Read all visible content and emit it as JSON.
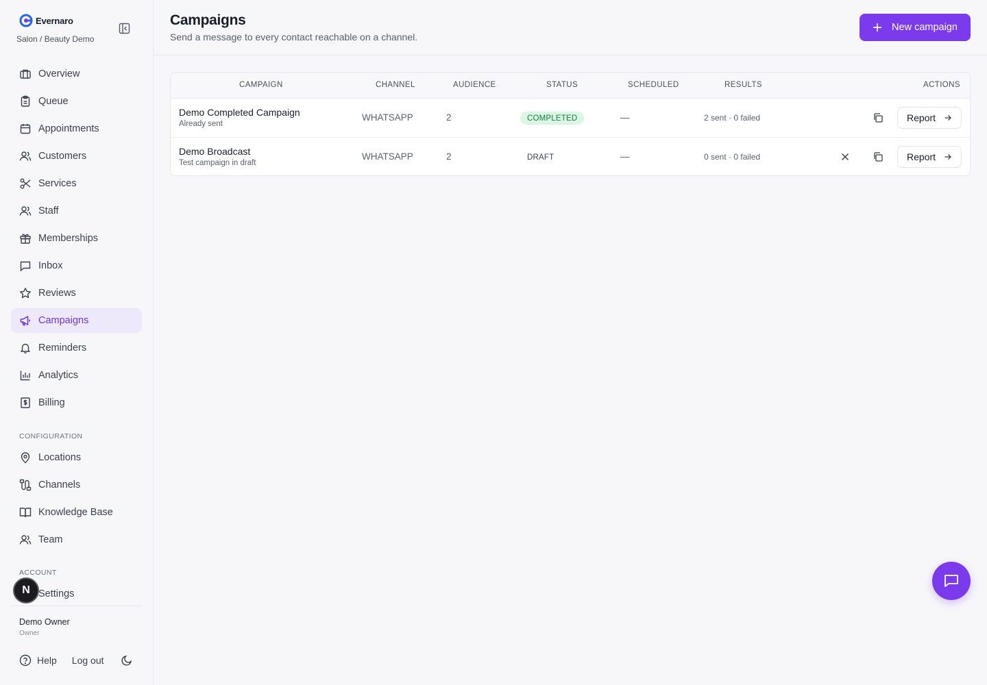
{
  "brand": {
    "name": "Evernaro",
    "workspace": "Salon / Beauty Demo"
  },
  "nav": {
    "items": [
      {
        "label": "Overview",
        "icon": "briefcase-icon"
      },
      {
        "label": "Queue",
        "icon": "clipboard-icon"
      },
      {
        "label": "Appointments",
        "icon": "calendar-icon"
      },
      {
        "label": "Customers",
        "icon": "users-icon"
      },
      {
        "label": "Services",
        "icon": "scissors-icon"
      },
      {
        "label": "Staff",
        "icon": "users-icon"
      },
      {
        "label": "Memberships",
        "icon": "gift-icon"
      },
      {
        "label": "Inbox",
        "icon": "message-square-icon"
      },
      {
        "label": "Reviews",
        "icon": "star-icon"
      },
      {
        "label": "Campaigns",
        "icon": "megaphone-icon",
        "active": true
      },
      {
        "label": "Reminders",
        "icon": "bell-icon"
      },
      {
        "label": "Analytics",
        "icon": "bar-chart-icon"
      },
      {
        "label": "Billing",
        "icon": "receipt-dollar-icon"
      }
    ],
    "configuration_label": "CONFIGURATION",
    "configuration": [
      {
        "label": "Locations",
        "icon": "map-pin-icon"
      },
      {
        "label": "Channels",
        "icon": "route-icon"
      },
      {
        "label": "Knowledge Base",
        "icon": "book-open-icon"
      },
      {
        "label": "Team",
        "icon": "users-icon"
      }
    ],
    "account_label": "ACCOUNT",
    "account": [
      {
        "label": "Settings",
        "icon": "gear-icon"
      }
    ]
  },
  "user": {
    "name": "Demo Owner",
    "role": "Owner",
    "avatar_letter": "N"
  },
  "footer": {
    "help": "Help",
    "logout": "Log out"
  },
  "header": {
    "title": "Campaigns",
    "subtitle": "Send a message to every contact reachable on a channel.",
    "new_button": "New campaign"
  },
  "table": {
    "columns": [
      "CAMPAIGN",
      "CHANNEL",
      "AUDIENCE",
      "STATUS",
      "SCHEDULED",
      "RESULTS",
      "ACTIONS"
    ],
    "rows": [
      {
        "name": "Demo Completed Campaign",
        "description": "Already sent",
        "channel": "WHATSAPP",
        "audience": "2",
        "status": "COMPLETED",
        "scheduled": "—",
        "results": "2 sent · 0 failed",
        "report": "Report"
      },
      {
        "name": "Demo Broadcast",
        "description": "Test campaign in draft",
        "channel": "WHATSAPP",
        "audience": "2",
        "status": "DRAFT",
        "scheduled": "—",
        "results": "0 sent · 0 failed",
        "report": "Report"
      }
    ]
  },
  "colors": {
    "accent": "#7c3aed",
    "active_bg": "#ede9fb",
    "completed_bg": "#dcf6e6",
    "completed_text": "#15803d"
  }
}
